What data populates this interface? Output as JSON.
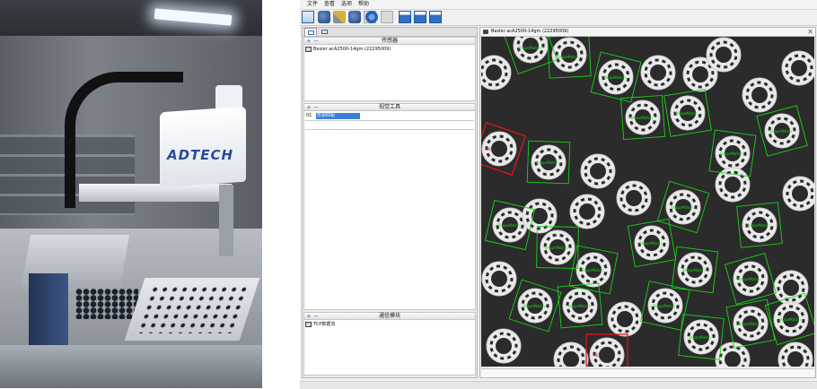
{
  "photo": {
    "brand_text": "ADTECH"
  },
  "menu": {
    "items": [
      "文件",
      "查看",
      "选项",
      "帮助"
    ]
  },
  "toolbar": {
    "icons": [
      "layout-icon",
      "camera-connect-icon",
      "tools-icon",
      "capture-icon",
      "save-icon",
      "record-icon",
      "disabled-icon",
      "layout-single-icon",
      "layout-split-icon",
      "layout-stack-icon"
    ]
  },
  "left_panel": {
    "tabs": [
      "device-tab",
      "list-tab"
    ],
    "sensor": {
      "title": "传感器",
      "camera_name": "Basler acA2500-14gm (22295009)"
    },
    "vision_tools": {
      "title": "视觉工具",
      "index": "01",
      "tool_name": "形状匹配"
    },
    "comm": {
      "title": "通信模块",
      "item": "TCP数据流"
    }
  },
  "view": {
    "title": "Basler acA2500-14gm (22295009)",
    "colors": {
      "match": "#19d219",
      "reject": "#e01616",
      "background": "#2b2b2b"
    },
    "detections": {
      "matched_label": "ShapeMatch",
      "rejected_label": "NG"
    }
  }
}
